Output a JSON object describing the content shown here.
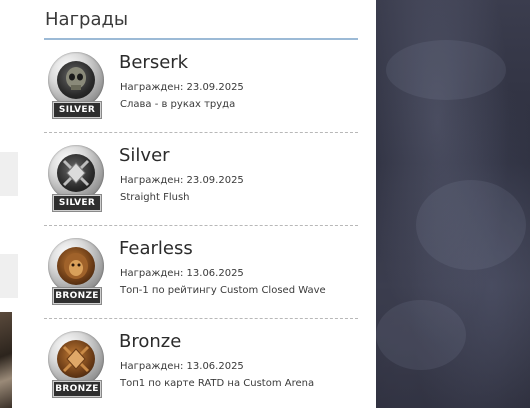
{
  "panel": {
    "title": "Награды",
    "awards": [
      {
        "name": "Berserk",
        "tier": "SILVER",
        "icon": "skull-medal-icon",
        "date_label": "Награжден: 23.09.2025",
        "description": "Слава - в руках труда"
      },
      {
        "name": "Silver",
        "tier": "SILVER",
        "icon": "diamond-swords-medal-icon",
        "date_label": "Награжден: 23.09.2025",
        "description": "Straight Flush"
      },
      {
        "name": "Fearless",
        "tier": "BRONZE",
        "icon": "lion-medal-icon",
        "date_label": "Награжден: 13.06.2025",
        "description": "Топ-1 по рейтингу Custom Closed Wave"
      },
      {
        "name": "Bronze",
        "tier": "BRONZE",
        "icon": "diamond-swords-medal-icon",
        "date_label": "Награжден: 13.06.2025",
        "description": "Топ1 по карте RATD на Custom Arena"
      }
    ]
  },
  "colors": {
    "title_underline": "#9cbad6",
    "badge_bg": "#2f2f2f",
    "art_bg": "#2c2e3d"
  }
}
